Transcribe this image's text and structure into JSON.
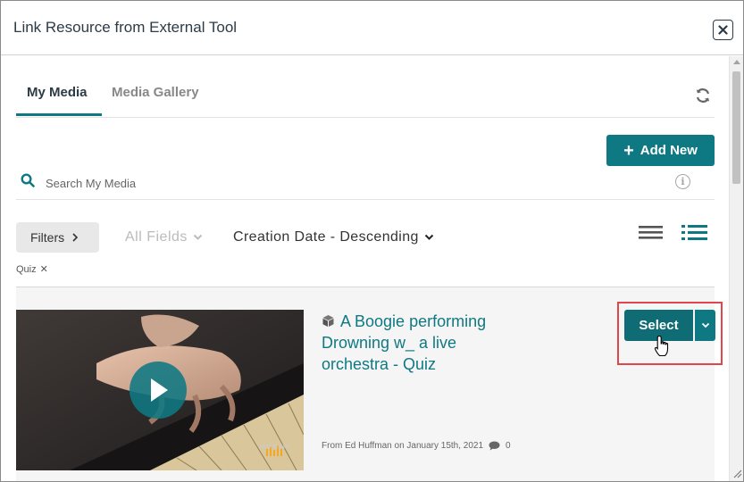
{
  "dialog": {
    "title": "Link Resource from External Tool",
    "close_icon": "close-icon"
  },
  "tabs": [
    {
      "label": "My Media",
      "active": true
    },
    {
      "label": "Media Gallery",
      "active": false
    }
  ],
  "toolbar": {
    "refresh_icon": "refresh-icon",
    "add_new_label": "Add New",
    "accent_color": "#0f7983"
  },
  "search": {
    "placeholder": "Search My Media",
    "value": ""
  },
  "filters": {
    "filters_label": "Filters",
    "fields_label": "All Fields",
    "sort_label": "Creation Date - Descending",
    "active_tag": "Quiz",
    "view_modes": [
      "list-view-icon",
      "detailed-list-view-icon"
    ]
  },
  "results": [
    {
      "title": "A Boogie performing Drowning w_ a live orchestra - Quiz",
      "type_icon": "cube-icon",
      "meta": "From Ed Huffman on January 15th, 2021",
      "comment_count": "0",
      "thumbnail_brand": "audiomack",
      "select_label": "Select"
    }
  ],
  "colors": {
    "accent": "#0f7983",
    "highlight": "#e2464d"
  }
}
